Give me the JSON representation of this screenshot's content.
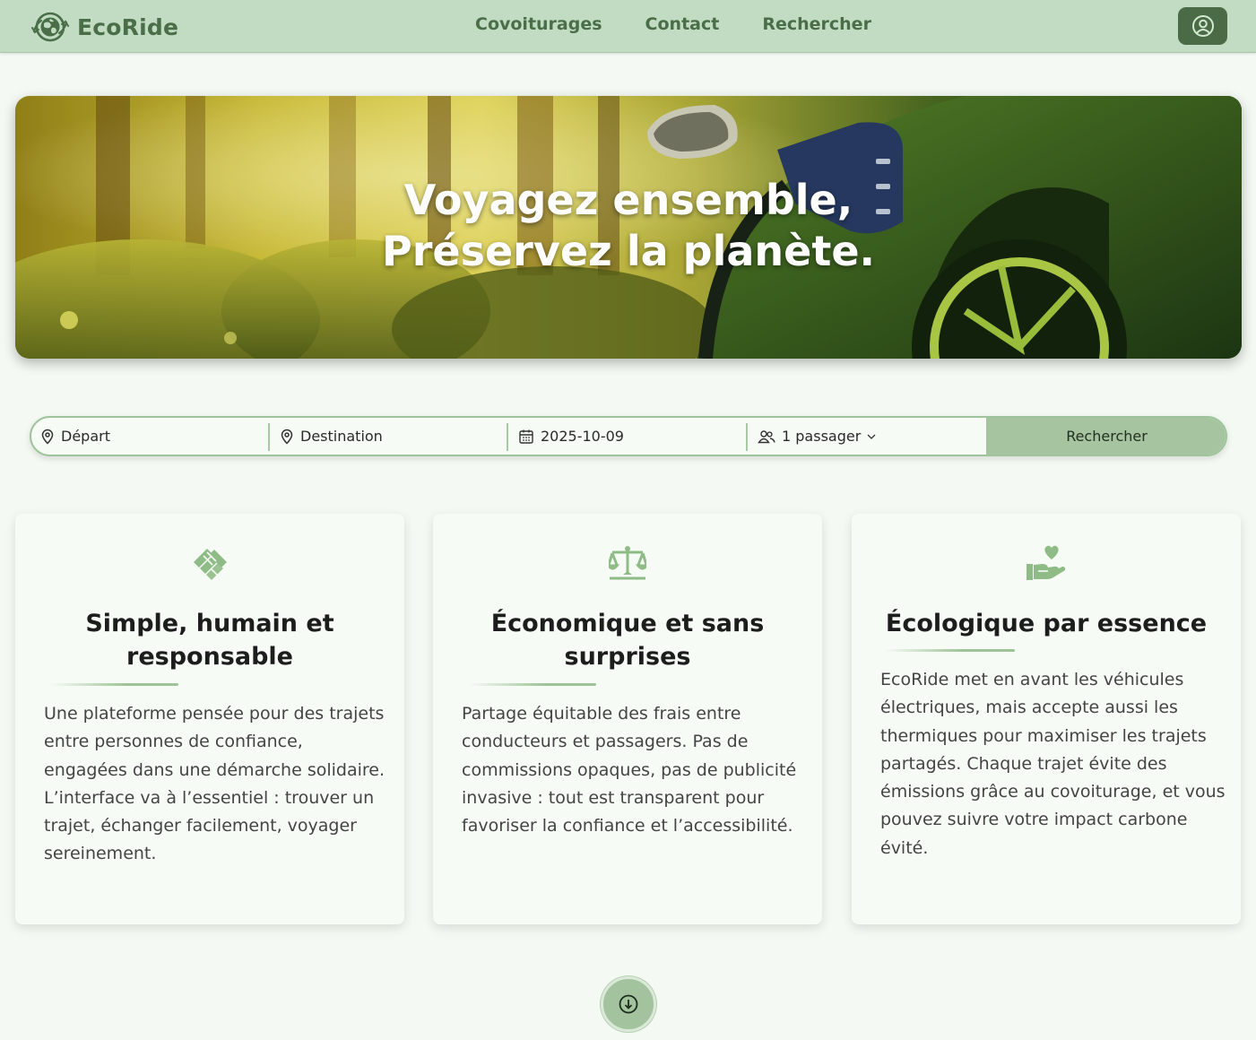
{
  "brand": {
    "name": "EcoRide",
    "logo_icon": "earth-globe-icon"
  },
  "nav": {
    "links": [
      {
        "label": "Covoiturages"
      },
      {
        "label": "Contact"
      },
      {
        "label": "Rechercher"
      }
    ],
    "user_icon": "user-circle-icon"
  },
  "hero": {
    "title_line1": "Voyagez ensemble,",
    "title_line2": "Préservez la planète."
  },
  "search": {
    "departure_placeholder": "Départ",
    "destination_placeholder": "Destination",
    "date_value": "2025-10-09",
    "passengers_value": "1 passager",
    "submit_label": "Rechercher"
  },
  "cards": [
    {
      "icon": "handshake-icon",
      "title": "Simple, humain et responsable",
      "text": "Une plateforme pensée pour des trajets entre personnes de confiance, engagées dans une démarche solidaire. L’interface va à l’essentiel : trouver un trajet, échanger facilement, voyager sereinement."
    },
    {
      "icon": "scale-balance-icon",
      "title": "Économique et sans surprises",
      "text": "Partage équitable des frais entre conducteurs et passagers. Pas de commissions opaques, pas de publicité invasive : tout est transparent pour favoriser la confiance et l’accessibilité."
    },
    {
      "icon": "hand-heart-icon",
      "title": "Écologique par essence",
      "text": "EcoRide met en avant les véhicules électriques, mais accepte aussi les thermiques pour maximiser les trajets partagés. Chaque trajet évite des émissions grâce au covoiturage, et vous pouvez suivre votre impact carbone évité."
    }
  ],
  "colors": {
    "navbar": "#c1dcc2",
    "brand_text": "#4a6e47",
    "accent": "#a5c49f",
    "page_bg": "#f4faf3"
  }
}
